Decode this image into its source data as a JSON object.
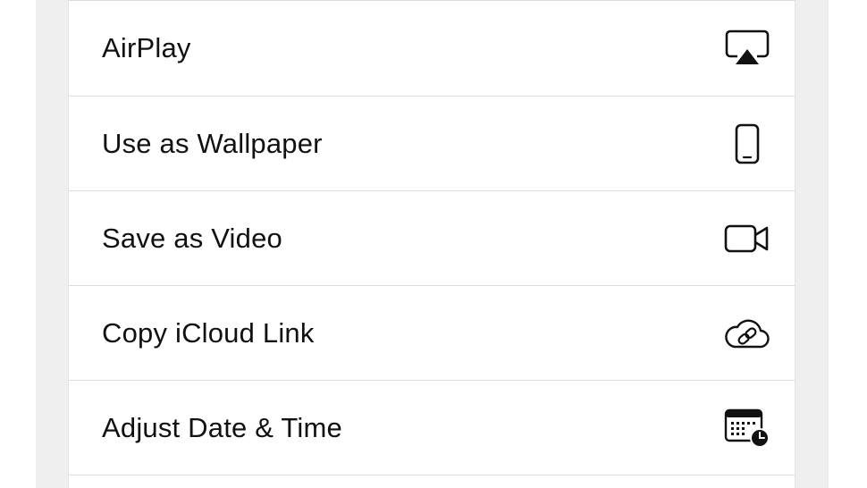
{
  "share_sheet": {
    "actions": [
      {
        "label": "AirPlay",
        "icon": "airplay-icon"
      },
      {
        "label": "Use as Wallpaper",
        "icon": "iphone-icon"
      },
      {
        "label": "Save as Video",
        "icon": "video-camera-icon"
      },
      {
        "label": "Copy iCloud Link",
        "icon": "icloud-link-icon"
      },
      {
        "label": "Adjust Date & Time",
        "icon": "calendar-clock-icon"
      }
    ]
  }
}
